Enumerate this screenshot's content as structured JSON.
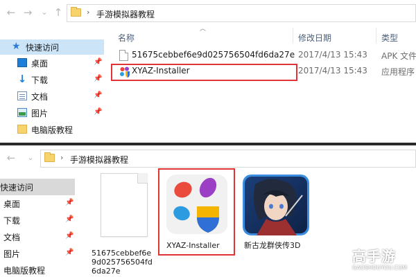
{
  "top": {
    "breadcrumb": "手游模拟器教程",
    "columns": {
      "name": "名称",
      "date": "修改日期",
      "type": "类型"
    },
    "sidebar": [
      {
        "label": "快速访问"
      },
      {
        "label": "桌面"
      },
      {
        "label": "下载"
      },
      {
        "label": "文档"
      },
      {
        "label": "图片"
      },
      {
        "label": "电脑版教程"
      }
    ],
    "files": [
      {
        "name": "51675cebbef6e9d025756504fd6da27e",
        "date": "2017/4/13 15:43",
        "type": "APK 文件"
      },
      {
        "name": "XYAZ-Installer",
        "date": "2017/4/13 15:43",
        "type": "应用程序"
      }
    ]
  },
  "bottom": {
    "breadcrumb": "手游模拟器教程",
    "sidebar": [
      {
        "label": "快速访问"
      },
      {
        "label": "桌面"
      },
      {
        "label": "下载"
      },
      {
        "label": "文档"
      },
      {
        "label": "图片"
      },
      {
        "label": "电脑版教程"
      }
    ],
    "tiles": [
      {
        "label": "51675cebbef6e9d025756504fd6da27e"
      },
      {
        "label": "XYAZ-Installer"
      },
      {
        "label": "新古龙群侠传3D"
      }
    ]
  },
  "watermark": {
    "brand": "高手游",
    "url": "GAOSHOUYOU.COM"
  },
  "colors": {
    "highlight": "#e03336",
    "selection": "#cce4f7",
    "accent": "#1e7fd8"
  }
}
